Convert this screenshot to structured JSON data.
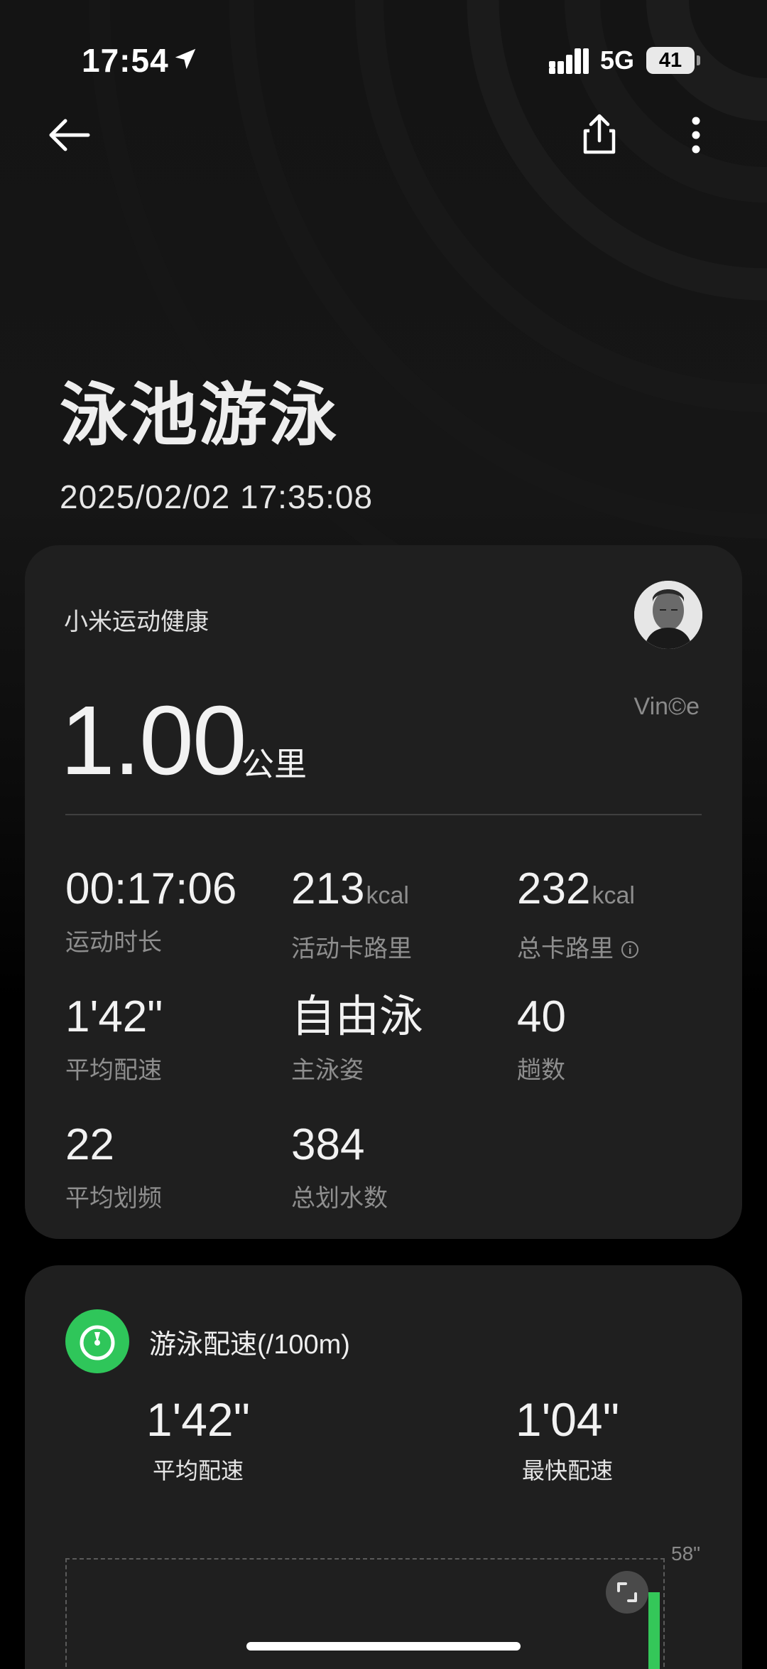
{
  "status_bar": {
    "time": "17:54",
    "network": "5G",
    "battery": "41"
  },
  "header": {
    "title": "泳池游泳",
    "datetime": "2025/02/02 17:35:08"
  },
  "summary": {
    "source": "小米运动健康",
    "watermark": "Vin©e",
    "distance": {
      "value": "1.00",
      "unit": "公里"
    },
    "stats": [
      {
        "value": "00:17:06",
        "unit": "",
        "label": "运动时长"
      },
      {
        "value": "213",
        "unit": "kcal",
        "label": "活动卡路里"
      },
      {
        "value": "232",
        "unit": "kcal",
        "label": "总卡路里"
      },
      {
        "value": "1'42\"",
        "unit": "",
        "label": "平均配速"
      },
      {
        "value": "自由泳",
        "unit": "",
        "label": "主泳姿"
      },
      {
        "value": "40",
        "unit": "",
        "label": "趟数"
      },
      {
        "value": "22",
        "unit": "",
        "label": "平均划频"
      },
      {
        "value": "384",
        "unit": "",
        "label": "总划水数"
      }
    ]
  },
  "pace": {
    "title": "游泳配速(/100m)",
    "avg": {
      "value": "1'42\"",
      "label": "平均配速"
    },
    "fastest": {
      "value": "1'04\"",
      "label": "最快配速"
    },
    "chart_max_label": "58\""
  },
  "colors": {
    "accent_green": "#2fc65a",
    "card_bg": "#1f1f1f",
    "muted_text": "#8e8e8e"
  },
  "icons": {
    "back": "back-arrow-icon",
    "share": "share-icon",
    "more": "more-vertical-icon",
    "location": "location-arrow-icon",
    "signal": "signal-icon",
    "info": "info-icon",
    "pace": "stopwatch-icon",
    "expand": "expand-icon"
  }
}
